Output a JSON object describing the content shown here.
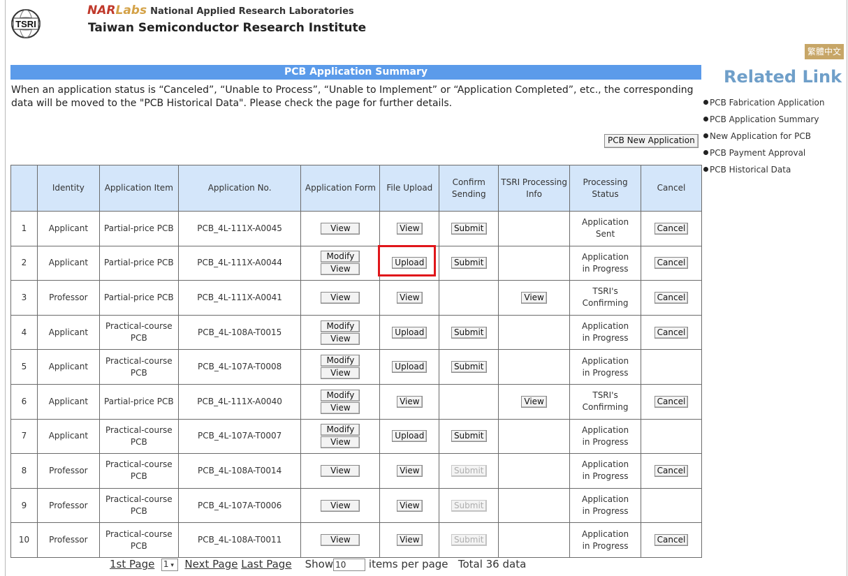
{
  "header": {
    "logo_text": "TSRI",
    "nar": "NAR",
    "labs": "Labs",
    "org_name": "National Applied Research Laboratories",
    "institute": "Taiwan Semiconductor Research Institute",
    "language_button": "繁體中文"
  },
  "page": {
    "title": "PCB Application Summary",
    "notice": "When an application status is “Canceled”, “Unable to Process”, “Unable to Implement” or “Application Completed”, etc., the corresponding data will be moved to the \"PCB Historical Data\". Please check the page for further details.",
    "new_application_button": "PCB New Application"
  },
  "table": {
    "headers": [
      "",
      "Identity",
      "Application Item",
      "Application No.",
      "Application Form",
      "File Upload",
      "Confirm Sending",
      "TSRI Processing Info",
      "Processing Status",
      "Cancel"
    ],
    "rows": [
      {
        "no": "1",
        "identity": "Applicant",
        "item": "Partial-price PCB",
        "app_no": "PCB_4L-111X-A0045",
        "form": [
          "View"
        ],
        "upload": "View",
        "confirm": "Submit",
        "confirm_disabled": false,
        "tsri": "",
        "status": "Application Sent",
        "cancel": "Cancel"
      },
      {
        "no": "2",
        "identity": "Applicant",
        "item": "Partial-price PCB",
        "app_no": "PCB_4L-111X-A0044",
        "form": [
          "Modify",
          "View"
        ],
        "upload": "Upload",
        "confirm": "Submit",
        "confirm_disabled": false,
        "tsri": "",
        "status": "Application in Progress",
        "cancel": "Cancel"
      },
      {
        "no": "3",
        "identity": "Professor",
        "item": "Partial-price PCB",
        "app_no": "PCB_4L-111X-A0041",
        "form": [
          "View"
        ],
        "upload": "View",
        "confirm": "",
        "confirm_disabled": false,
        "tsri": "View",
        "status": "TSRI's Confirming",
        "cancel": "Cancel"
      },
      {
        "no": "4",
        "identity": "Applicant",
        "item": "Practical-course PCB",
        "app_no": "PCB_4L-108A-T0015",
        "form": [
          "Modify",
          "View"
        ],
        "upload": "Upload",
        "confirm": "Submit",
        "confirm_disabled": false,
        "tsri": "",
        "status": "Application in Progress",
        "cancel": "Cancel"
      },
      {
        "no": "5",
        "identity": "Applicant",
        "item": "Practical-course PCB",
        "app_no": "PCB_4L-107A-T0008",
        "form": [
          "Modify",
          "View"
        ],
        "upload": "Upload",
        "confirm": "Submit",
        "confirm_disabled": false,
        "tsri": "",
        "status": "Application in Progress",
        "cancel": ""
      },
      {
        "no": "6",
        "identity": "Applicant",
        "item": "Partial-price PCB",
        "app_no": "PCB_4L-111X-A0040",
        "form": [
          "Modify",
          "View"
        ],
        "upload": "View",
        "confirm": "",
        "confirm_disabled": false,
        "tsri": "View",
        "status": "TSRI's Confirming",
        "cancel": "Cancel"
      },
      {
        "no": "7",
        "identity": "Applicant",
        "item": "Practical-course PCB",
        "app_no": "PCB_4L-107A-T0007",
        "form": [
          "Modify",
          "View"
        ],
        "upload": "Upload",
        "confirm": "Submit",
        "confirm_disabled": false,
        "tsri": "",
        "status": "Application in Progress",
        "cancel": ""
      },
      {
        "no": "8",
        "identity": "Professor",
        "item": "Practical-course PCB",
        "app_no": "PCB_4L-108A-T0014",
        "form": [
          "View"
        ],
        "upload": "View",
        "confirm": "Submit",
        "confirm_disabled": true,
        "tsri": "",
        "status": "Application in Progress",
        "cancel": "Cancel"
      },
      {
        "no": "9",
        "identity": "Professor",
        "item": "Practical-course PCB",
        "app_no": "PCB_4L-107A-T0006",
        "form": [
          "View"
        ],
        "upload": "View",
        "confirm": "Submit",
        "confirm_disabled": true,
        "tsri": "",
        "status": "Application in Progress",
        "cancel": ""
      },
      {
        "no": "10",
        "identity": "Professor",
        "item": "Practical-course PCB",
        "app_no": "PCB_4L-108A-T0011",
        "form": [
          "View"
        ],
        "upload": "View",
        "confirm": "Submit",
        "confirm_disabled": true,
        "tsri": "",
        "status": "Application in Progress",
        "cancel": "Cancel"
      }
    ]
  },
  "pager": {
    "first": "1st Page",
    "page_select": "1",
    "next": "Next Page",
    "last": "Last Page",
    "show_label": "Show",
    "per_page_value": "10",
    "per_page_suffix": "items per page",
    "total": "Total 36 data"
  },
  "sidebar": {
    "title": "Related Link",
    "links": [
      "PCB Fabrication Application",
      "PCB Application Summary",
      "New Application for PCB",
      "PCB Payment Approval",
      "PCB Historical Data"
    ]
  },
  "colors": {
    "title_bar": "#5b9bea",
    "header_cells": "#d4e6fa",
    "related_title": "#6f9fc9",
    "language_button": "#c7a667",
    "highlight": "#e0161a"
  }
}
